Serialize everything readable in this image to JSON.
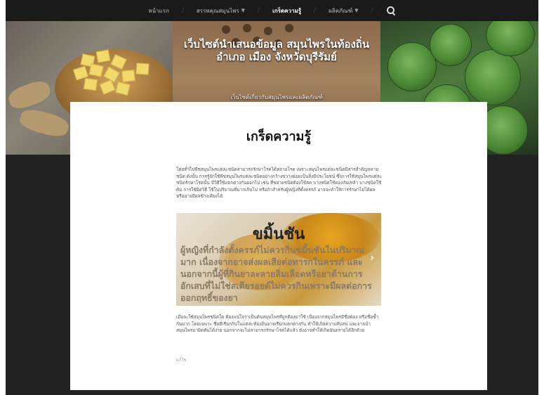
{
  "nav": {
    "items": [
      {
        "label": "หน้าแรก",
        "dropdown": false,
        "active": false
      },
      {
        "label": "สรรพคุณสมุนไพร",
        "dropdown": true,
        "active": false
      },
      {
        "label": "เกร็ดความรู้",
        "dropdown": false,
        "active": true
      },
      {
        "label": "ผลิตภัณฑ์",
        "dropdown": true,
        "active": false
      }
    ],
    "search_icon": "search-icon"
  },
  "hero": {
    "title": "เว็บไซต์นำเสนอข้อมูล สมุนไพรในท้องถิ่น อำเภอ เมือง จังหวัดบุรีรัมย์",
    "subtitle": "เว็บไซต์เกี่ยวกับสมุนไพรและผลิตภัณฑ์"
  },
  "article": {
    "title": "เกร็ดความรู้",
    "intro": "โดยทั่วไปพืชสมุนไพรแต่ละชนิดสามารถรักษาโรคได้หลายโรค เพราะสมุนไพรแต่ละชนิดมีสารสำคัญหลายชนิด ดังนั้น การรู้จักใช้พืชสมุนไพรแต่ละชนิดอย่างกว้างขวางย่อมเป็นสิ่งมีประโยชน์ ซึ่งการใช้สมุนไพรแต่ละชนิดรักษาโรคนั้น มีวิธีใช้แตกต่างกันออกไป เช่น ที่ขยายชนิดต้องใช้สด บางชนิดใช้ดองกับเหล้า บางชนิดใช้ต้ม การใช้ผิดวิธี ใช้ในปริมาณที่มากเกินไป หรือถ้าสำหรับผู้หญิงที่ตั้งครรภ์ อาจจะทำให้การรักษาไม่ได้ผล หรืออาจมีผลข้างเคียงได้",
    "banner": {
      "title": "ขมิ้นชัน",
      "text": "ผู้หญิงที่กำลังตั้งครรภ์ไม่ควรกินขมิ้นชันในปริมาณมาก เนื่องจากอาจส่งผลเสียต่อทารกในครรภ์ และนอกจากนี้ผู้ที่กินยาละลายลิ่มเลือดหรือยาต้านการอักเสบที่ไม่ใช่สเตียรอยด์ไม่ควรกินเพราะมีผลต่อการออกฤทธิ์ของยา",
      "arrow": "›"
    },
    "body": "เมื่อจะใช้สมุนไพรชนิดใด ต้องแน่ใจว่าเป็นต้นสมุนไพรที่ถูกต้องมาใช้ เนื่องจากสมุนไพรมีชื่อพ้อง หรือชื่อซ้ำกันมาก โดยเฉพาะ ชื่อที่เรียกกันในแต่ละท้องถิ่นอาจเรียกแตกต่างกัน ทำให้เกิดความสับสน และอาจนำสมุนไพรมาผิดทันได้ง่าย นอกจากจะไม่สามารถรักษาโรคได้แล้ว ยังอาจทำให้เกิดอันตรายได้อีกด้วย",
    "edit_label": "แก้ไข"
  }
}
